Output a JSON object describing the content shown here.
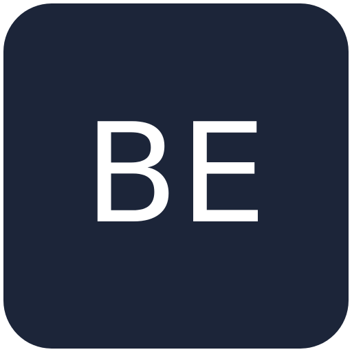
{
  "icon": {
    "text": "BE",
    "background_color": "#1c2539",
    "text_color": "#ffffff"
  }
}
